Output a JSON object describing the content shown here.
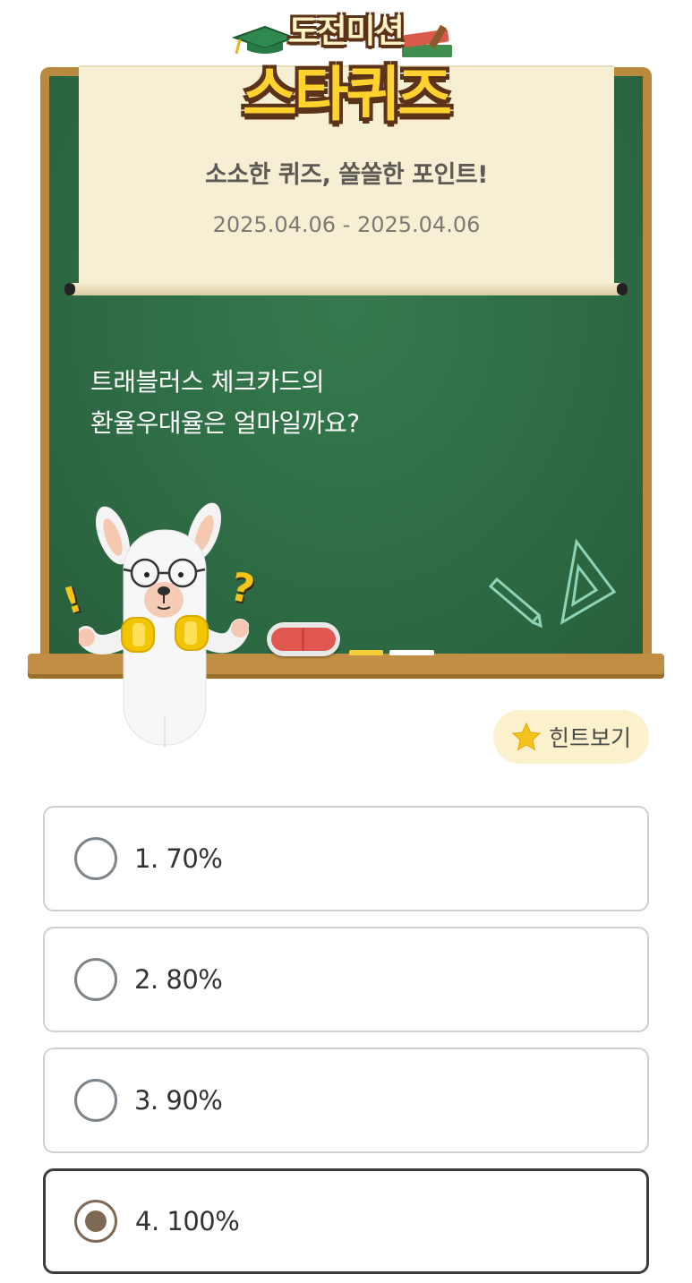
{
  "header": {
    "logo_top": "도전미션",
    "logo_main": "스타퀴즈"
  },
  "quiz": {
    "title": "소소한 퀴즈, 쏠쏠한 포인트!",
    "date_range": "2025.04.06 - 2025.04.06",
    "question_line1": "트래블러스 체크카드의",
    "question_line2": "환율우대율은 얼마일까요?"
  },
  "hint": {
    "label": "힌트보기",
    "icon": "star-icon"
  },
  "options": [
    {
      "label": "1. 70%",
      "selected": false
    },
    {
      "label": "2. 80%",
      "selected": false
    },
    {
      "label": "3. 90%",
      "selected": false
    },
    {
      "label": "4. 100%",
      "selected": true
    }
  ],
  "colors": {
    "board": "#2f6e46",
    "frame": "#b98a3e",
    "paper": "#f6efd3",
    "logo": "#ffd22e",
    "hint_bg": "#fbf1cc",
    "selected_radio": "#7c6a57"
  }
}
